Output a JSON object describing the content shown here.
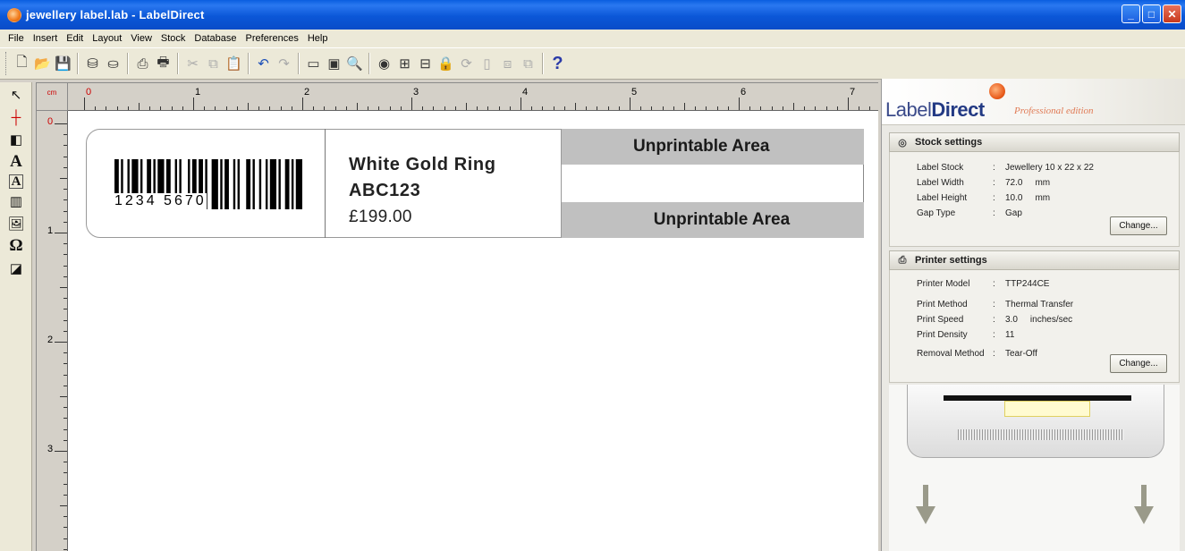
{
  "window": {
    "title": "jewellery label.lab - LabelDirect",
    "minimize_glyph": "_",
    "maximize_glyph": "□",
    "close_glyph": "✕"
  },
  "menu": {
    "items": [
      "File",
      "Insert",
      "Edit",
      "Layout",
      "View",
      "Stock",
      "Database",
      "Preferences",
      "Help"
    ]
  },
  "toolbar": {
    "help_glyph": "?"
  },
  "rulers": {
    "unit": "cm",
    "h_numbers": [
      "0",
      "1",
      "2",
      "3",
      "4",
      "5",
      "6",
      "7"
    ],
    "v_numbers": [
      "0",
      "1",
      "2",
      "3"
    ]
  },
  "label": {
    "barcode_digits": "1234  5670",
    "line1": "White Gold Ring",
    "line2": "ABC123",
    "line3": "£199.00",
    "unprintable_top": "Unprintable Area",
    "unprintable_bottom": "Unprintable Area"
  },
  "panel": {
    "brand_label": "Label",
    "brand_direct": "Direct",
    "edition": "Professional edition",
    "stock": {
      "heading": "Stock settings",
      "rows": [
        {
          "key": "Label Stock",
          "sep": ":",
          "value": "Jewellery 10 x 22 x 22",
          "unit": ""
        },
        {
          "key": "Label Width",
          "sep": ":",
          "value": "72.0",
          "unit": "mm"
        },
        {
          "key": "Label Height",
          "sep": ":",
          "value": "10.0",
          "unit": "mm"
        },
        {
          "key": "Gap Type",
          "sep": ":",
          "value": "Gap",
          "unit": ""
        }
      ],
      "change_label": "Change..."
    },
    "printer": {
      "heading": "Printer settings",
      "rows": [
        {
          "key": "Printer Model",
          "sep": ":",
          "value": "TTP244CE",
          "unit": ""
        },
        {
          "key": "Print Method",
          "sep": ":",
          "value": "Thermal Transfer",
          "unit": ""
        },
        {
          "key": "Print Speed",
          "sep": ":",
          "value": "3.0",
          "unit": "inches/sec"
        },
        {
          "key": "Print Density",
          "sep": ":",
          "value": "11",
          "unit": ""
        },
        {
          "key": "Removal Method",
          "sep": ":",
          "value": "Tear-Off",
          "unit": ""
        }
      ],
      "change_label": "Change..."
    }
  }
}
